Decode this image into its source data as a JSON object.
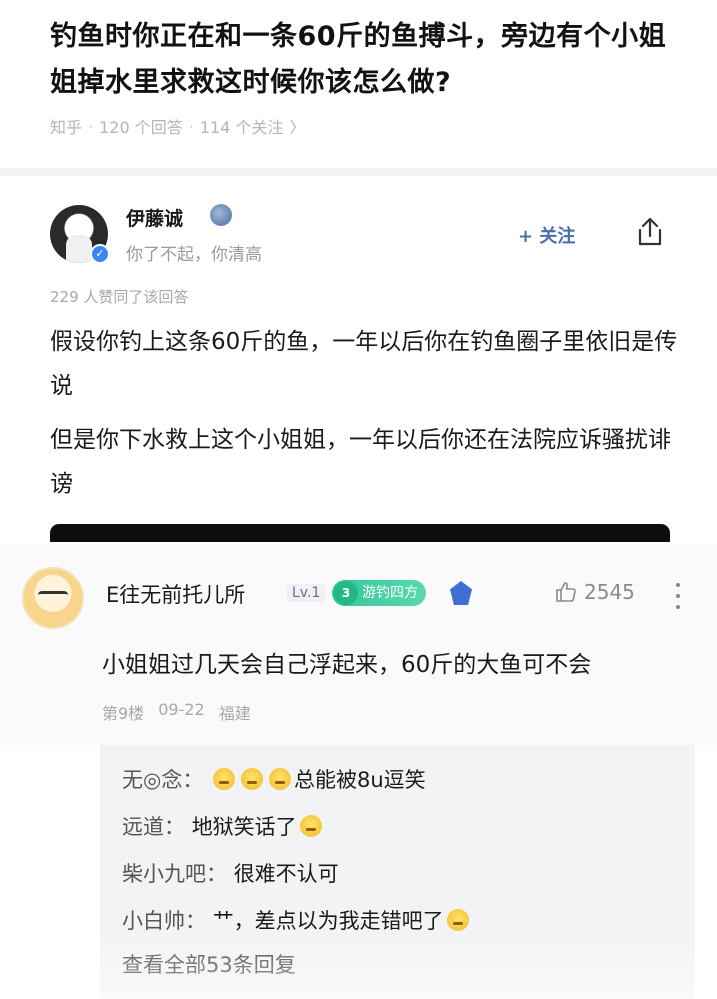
{
  "question": {
    "title": "钓鱼时你正在和一条60斤的鱼搏斗，旁边有个小姐姐掉水里求救这时候你该怎么做?",
    "source": "知乎",
    "answers": "120 个回答",
    "followers": "114 个关注",
    "chevron": "〉"
  },
  "answer": {
    "author": "伊藤诚",
    "bio": "你了不起，你清高",
    "follow_label": "+ 关注",
    "likes_text": "229 人赞同了该回答",
    "paragraphs": [
      "假设你钓上这条60斤的鱼，一年以后你在钓鱼圈子里依旧是传说",
      "但是你下水救上这个小姐姐，一年以后你还在法院应诉骚扰诽谤"
    ]
  },
  "comment": {
    "author": "E往无前托儿所",
    "level": "Lv.1",
    "tag_level": "3",
    "tag": "游钓四方",
    "likes": "2545",
    "text": "小姐姐过几天会自己浮起来，60斤的大鱼可不会",
    "floor": "第9楼",
    "date": "09-22",
    "location": "福建"
  },
  "replies": [
    {
      "name": "无◎念",
      "text": "总能被8u逗笑",
      "emojis_before": 3,
      "emojis_after": 0
    },
    {
      "name": "远道",
      "text": "地狱笑话了",
      "emojis_before": 0,
      "emojis_after": 1
    },
    {
      "name": "柴小九吧",
      "text": "很难不认可",
      "emojis_before": 0,
      "emojis_after": 0
    },
    {
      "name": "小白帅",
      "text": "艹，差点以为我走错吧了",
      "emojis_before": 0,
      "emojis_after": 1
    }
  ],
  "view_all": "查看全部53条回复",
  "colors": {
    "link": "#4a6ea8",
    "tag_green": "#34c79a",
    "verify_blue": "#3b86f5"
  }
}
